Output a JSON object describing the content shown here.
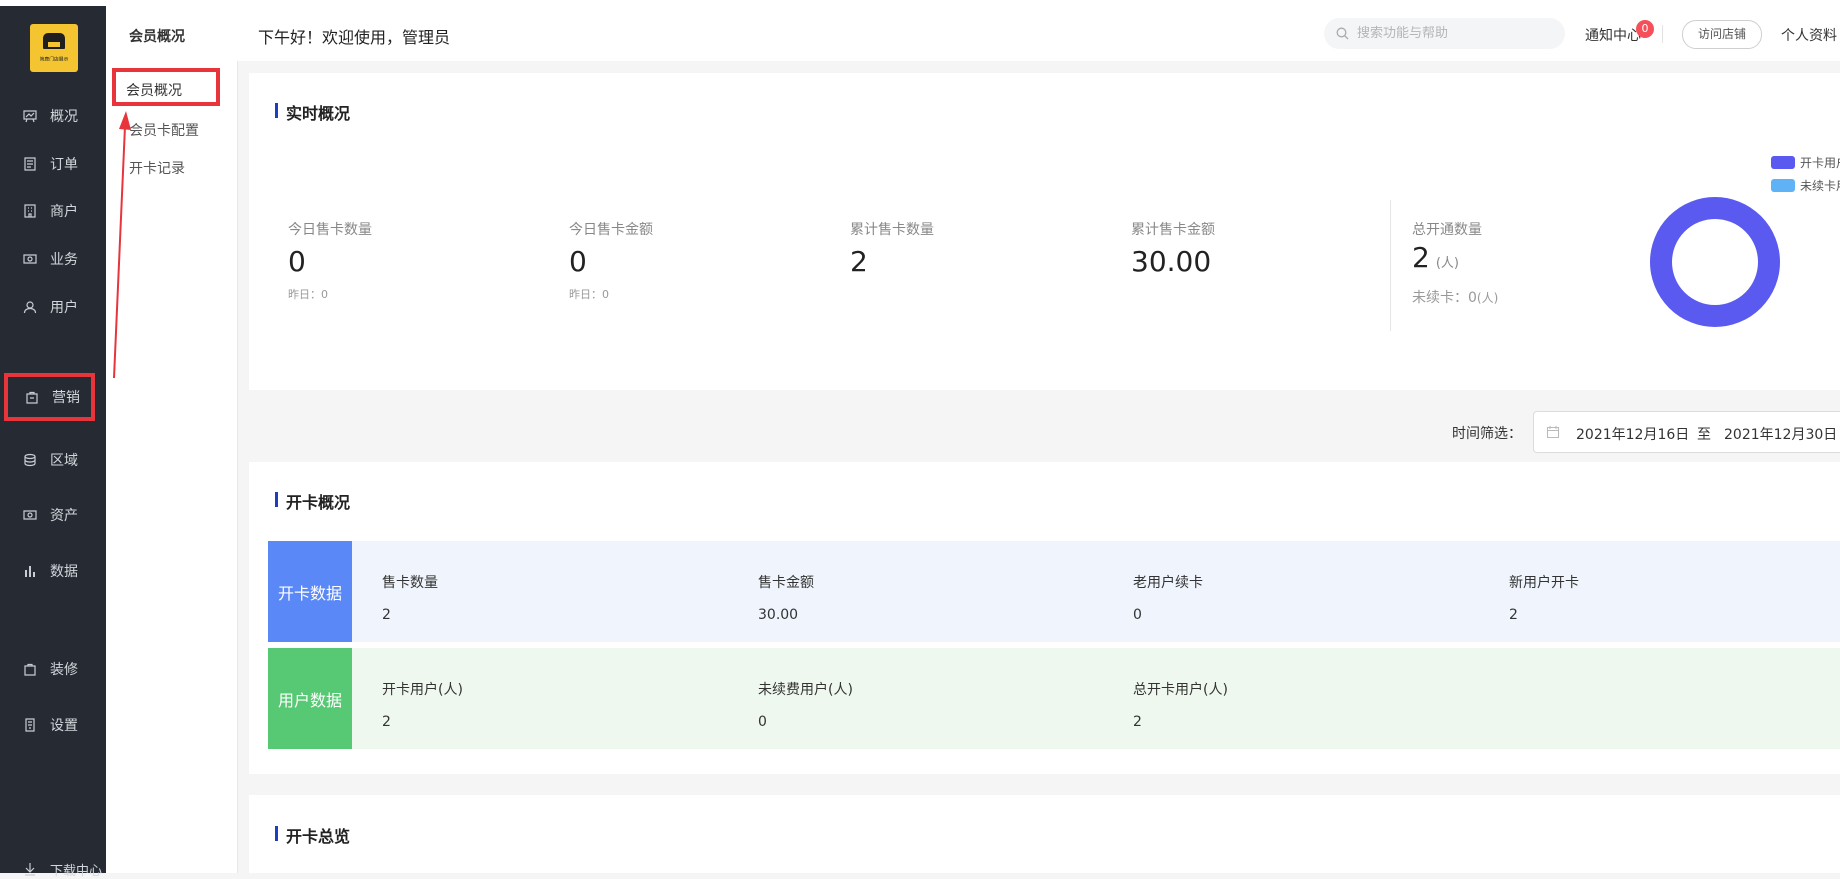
{
  "logo": {
    "text": "简鹿门店展示",
    "alt": "store-logo"
  },
  "nav": {
    "items": [
      {
        "label": "概况",
        "icon": "chart-board-icon"
      },
      {
        "label": "订单",
        "icon": "document-icon"
      },
      {
        "label": "商户",
        "icon": "building-icon"
      },
      {
        "label": "业务",
        "icon": "money-icon"
      },
      {
        "label": "用户",
        "icon": "user-icon"
      },
      {
        "label": "营销",
        "icon": "bag-icon",
        "active": true
      },
      {
        "label": "区域",
        "icon": "layers-icon"
      },
      {
        "label": "资产",
        "icon": "cash-icon"
      },
      {
        "label": "数据",
        "icon": "bar-chart-icon"
      },
      {
        "label": "装修",
        "icon": "shopping-bag-icon"
      },
      {
        "label": "设置",
        "icon": "settings-icon"
      }
    ],
    "bottom_label": "下载中心",
    "highlight_color": "#e8343b"
  },
  "subnav": {
    "title": "会员概况",
    "items": [
      {
        "label": "会员概况",
        "active": true
      },
      {
        "label": "会员卡配置"
      },
      {
        "label": "开卡记录"
      }
    ]
  },
  "header": {
    "greeting": "下午好！欢迎使用，管理员",
    "search_placeholder": "搜索功能与帮助",
    "notify_label": "通知中心",
    "notify_count": "0",
    "visit_label": "访问店铺",
    "profile_label": "个人资料"
  },
  "realtime": {
    "title": "实时概况",
    "stats": [
      {
        "label": "今日售卡数量",
        "value": "0",
        "sub": "昨日：0"
      },
      {
        "label": "今日售卡金额",
        "value": "0",
        "sub": "昨日：0"
      },
      {
        "label": "累计售卡数量",
        "value": "2",
        "sub": ""
      },
      {
        "label": "累计售卡金额",
        "value": "30.00",
        "sub": ""
      }
    ],
    "total": {
      "label": "总开通数量",
      "value": "2",
      "unit": "(人)",
      "unrenew_label": "未续卡：0",
      "unrenew_unit": "(人)"
    },
    "legend": [
      {
        "label": "开卡用户",
        "color": "#5a5af0"
      },
      {
        "label": "未续卡用户",
        "color": "#5fb2f5"
      }
    ],
    "donut": {
      "open_users": 2,
      "unrenewed_users": 0
    }
  },
  "filter": {
    "label": "时间筛选：",
    "start": "2021年12月16日",
    "sep": "至",
    "end": "2021年12月30日"
  },
  "open_overview": {
    "title": "开卡概况",
    "card_data": {
      "tag": "开卡数据",
      "color": "#5b88f7",
      "bg": "#eff4fd",
      "cells": [
        {
          "header": "售卡数量",
          "value": "2"
        },
        {
          "header": "售卡金额",
          "value": "30.00"
        },
        {
          "header": "老用户续卡",
          "value": "0"
        },
        {
          "header": "新用户开卡",
          "value": "2"
        }
      ]
    },
    "user_data": {
      "tag": "用户数据",
      "color": "#57c873",
      "bg": "#eff8ee",
      "cells": [
        {
          "header": "开卡用户(人)",
          "value": "2"
        },
        {
          "header": "未续费用户(人)",
          "value": "0"
        },
        {
          "header": "总开卡用户(人)",
          "value": "2"
        }
      ]
    }
  },
  "summary": {
    "title": "开卡总览"
  }
}
